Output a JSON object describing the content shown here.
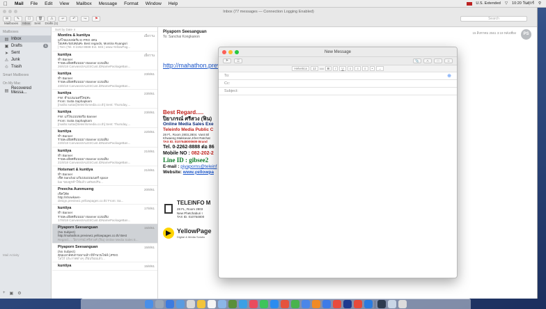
{
  "menubar": {
    "app": "Mail",
    "items": [
      "File",
      "Edit",
      "View",
      "Mailbox",
      "Message",
      "Format",
      "Window",
      "Help"
    ],
    "status": [
      "U.S. Extended",
      "10:20 วันศุกร์"
    ]
  },
  "window": {
    "title": "Inbox (77 messages — Connection Logging Enabled)",
    "favorites": [
      "Mailboxes",
      "Inbox",
      "Sent",
      "Drafts (1)"
    ],
    "search_placeholder": "Search"
  },
  "sidebar": {
    "header": "Mailboxes",
    "items": [
      {
        "label": "Inbox",
        "icon": "inbox-icon"
      },
      {
        "label": "Drafts",
        "badge": "1",
        "icon": "doc-icon"
      },
      {
        "label": "Sent",
        "icon": "paper-plane-icon"
      },
      {
        "label": "Junk",
        "icon": "junk-icon"
      },
      {
        "label": "Trash",
        "icon": "trash-icon"
      }
    ],
    "section2": "Smart Mailboxes",
    "section3": "On My Mac",
    "local": [
      {
        "label": "Recovered Messa...",
        "icon": "folder-icon"
      }
    ],
    "activity": "Mail Activity"
  },
  "messages": {
    "sort_label": "Sort by Date ∨",
    "items": [
      {
        "from": "Montira & kuntiya",
        "date": "เมื่อวาน",
        "lines": [
          "แก้ไขแบบฟอร์ม E-PRO 4คน",
          "โอเคค่ะขอบคุณค่ะ Best regards, Montira Ruangsri",
          "| Tem (Tel. 0-2262-8888 Ext. 845 | www.YellowPag..."
        ]
      },
      {
        "from": "kuntiya",
        "date": "เมื่อวาน",
        "lines": [
          "ทำ Banner",
          "รายละเอียดที่แนบมา Banner แบบเดิม",
          "26/6/18 CanvassSALESCust.iDNamePackageBan..."
        ]
      },
      {
        "from": "kuntiya",
        "date": "23/8/61",
        "lines": [
          "ทำ Banner",
          "รายละเอียดที่แนบมา Banner แบบเดิม",
          "23/8/18 CanvassSALESCust.iDNamePackageBan..."
        ]
      },
      {
        "from": "kuntiya",
        "date": "23/8/61",
        "lines": [
          "FW: ทำแบนเนอร์ใหม่ค่ะ",
          "From: Sutta Saphapkarn",
          "[mailto:sutta@teleinfomedia.co.th] Sent: Thursday,..."
        ]
      },
      {
        "from": "kuntiya",
        "date": "23/8/61",
        "lines": [
          "FW: แก้ไขแบบฟอร์ม Banner",
          "From: Sutta Saphapkarn",
          "[mailto:sutta@teleinfomedia.co.th] Sent: Thursday,..."
        ]
      },
      {
        "from": "kuntiya",
        "date": "22/8/61",
        "lines": [
          "ทำ Banner",
          "รายละเอียดที่แนบมา Banner แบบเดิม",
          "22/8/18 CanvassSALESCust.iDNamePackageBan..."
        ]
      },
      {
        "from": "kuntiya",
        "date": "21/8/61",
        "lines": [
          "ทำ Banner",
          "รายละเอียดที่แนบมา Banner แบบเดิม",
          "21/8/18 CanvassSALESCust.iDNamePackageBan..."
        ]
      },
      {
        "from": "Hotsmart & kuntiya",
        "date": "21/8/61",
        "lines": [
          "ทำ Banner",
          "เชิด Sanchai แก้แบบแบนเนอร์ space",
          "bar ของลูกค้าให้แล้ว แต่ขอปรับ..."
        ]
      },
      {
        "from": "Preecha Aunmueng",
        "date": "20/8/61",
        "lines": [
          "เช็คโค้ด",
          "http://showkaen-",
          "design.preview1.yellowpages.co.th/ From: Sa..."
        ]
      },
      {
        "from": "kuntiya",
        "date": "17/8/61",
        "lines": [
          "ทำ Banner",
          "รายละเอียดที่แนบมา Banner แบบเดิม",
          "17/8/18 CanvassSALESCust.iDNamePackageBan..."
        ]
      },
      {
        "from": "Piyaporn Seesanguan",
        "date": "15/8/61",
        "lines": [
          "(No Subject)",
          "http://mahathon.preview1.yellowpages.co.th/ Best",
          "Regard..... ปิยาภรณ์ ศรีสวงค์ (ฟิน) Online Media Sales E..."
        ],
        "selected": true
      },
      {
        "from": "Piyaporn Seesanguan",
        "date": "15/8/61",
        "lines": [
          "(No Subject)",
          "คุณแมวสอบถามมาแล้ว มีจำนวนไฟล์ (JPEG",
          "โลโก้ ประกาศต่างๆ เรียบร้อยแล้ว..."
        ]
      },
      {
        "from": "kuntiya",
        "date": "15/8/61",
        "lines": []
      }
    ]
  },
  "reader": {
    "from": "Piyaporn Seesanguan",
    "to": "To:  Sanchai Kongkanon",
    "date": "15 สิงหาคม 2561 3:19 หลังเที่ยง",
    "avatar": "PS",
    "link": "http://mahathon.previ",
    "signature": {
      "best": "Best Regard.....",
      "name": "ปิยาภรณ์ ศรีสวง (ฟิน)",
      "title": "Online Media Sales Exe",
      "company": "Teleinfo Media Public C",
      "addr1": "28 Fl., Room 2803,2804. Vanit Bl",
      "addr2": "Khwaeng Makkasan,Khet Ratchat",
      "tax": "TAX ID. 0107548000609 Brand",
      "tel": "Tel. 0-2262-8888 ต่อ 86",
      "mobile_label": "Mobile NO : ",
      "mobile": "082-202-2",
      "line": "Line ID  : gibsee2",
      "email_label": "E-mail : ",
      "email": "piyaporns@teleinf",
      "web_label": "Website: ",
      "web": "www.yellowpa"
    },
    "logo_teleinfo": {
      "title": "TELEINFO M",
      "l1": "28 FL, Room 2803",
      "l2": "New Phetchaburi I",
      "l3": "TAX ID. 010754800"
    },
    "logo_yp": {
      "title": "YellowPage",
      "sub": "Digital & Media Solutio"
    }
  },
  "compose": {
    "title": "New Message",
    "font": "Helvetica",
    "size": "12",
    "to_label": "To:",
    "cc_label": "Cc:",
    "subject_label": "Subject:"
  },
  "colors": {
    "accent": "#3b82f6",
    "link": "#1a55c9",
    "brand_red": "#c0221c"
  }
}
